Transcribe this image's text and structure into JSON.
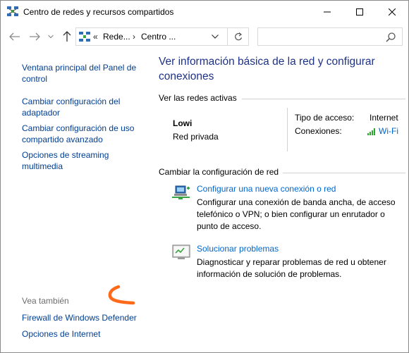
{
  "window": {
    "title": "Centro de redes y recursos compartidos",
    "buttons": {
      "minimize": "minimize-icon",
      "maximize": "maximize-icon",
      "close": "close-icon"
    }
  },
  "navbar": {
    "breadcrumb_sep": "«",
    "crumbs": [
      "Rede...",
      "Centro ..."
    ],
    "crumb_separator": "›",
    "search_placeholder": ""
  },
  "sidebar": {
    "links": [
      "Ventana principal del Panel de control",
      "Cambiar configuración del adaptador",
      "Cambiar configuración de uso compartido avanzado",
      "Opciones de streaming multimedia"
    ],
    "see_also_label": "Vea también",
    "see_also_links": [
      "Firewall de Windows Defender",
      "Opciones de Internet"
    ]
  },
  "main": {
    "heading": "Ver información básica de la red y configurar conexiones",
    "active_networks": {
      "title": "Ver las redes activas",
      "network_name": "Lowi",
      "network_type": "Red privada",
      "access_type_label": "Tipo de acceso:",
      "access_type_value": "Internet",
      "connections_label": "Conexiones:",
      "connection_name": "Wi-Fi"
    },
    "change_settings": {
      "title": "Cambiar la configuración de red",
      "tasks": [
        {
          "link": "Configurar una nueva conexión o red",
          "description": "Configurar una conexión de banda ancha, de acceso telefónico o VPN; o bien configurar un enrutador o punto de acceso."
        },
        {
          "link": "Solucionar problemas",
          "description": "Diagnosticar y reparar problemas de red u obtener información de solución de problemas."
        }
      ]
    }
  },
  "colors": {
    "link": "#0066cc",
    "left_link": "#003e92",
    "heading": "#1e3287",
    "annotation": "#ff6a1a",
    "wifi_bars": "#2aa830"
  }
}
